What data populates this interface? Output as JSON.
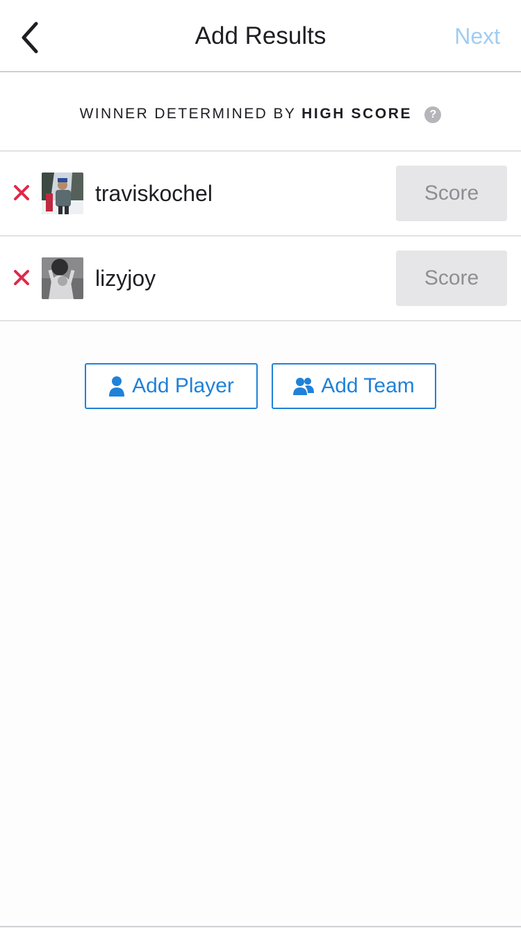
{
  "nav": {
    "back_icon": "chevron-left-icon",
    "title": "Add Results",
    "next_label": "Next"
  },
  "winner": {
    "prefix": "WINNER DETERMINED BY",
    "method": "HIGH SCORE",
    "help_glyph": "?"
  },
  "players": [
    {
      "name": "traviskochel",
      "score_placeholder": "Score",
      "score_value": ""
    },
    {
      "name": "lizyjoy",
      "score_placeholder": "Score",
      "score_value": ""
    }
  ],
  "actions": {
    "add_player_label": "Add Player",
    "add_team_label": "Add Team"
  },
  "colors": {
    "accent_blue": "#1f82d8",
    "next_disabled": "#9fcdf2",
    "remove_red": "#e0284a",
    "score_bg": "#e6e6e8"
  }
}
